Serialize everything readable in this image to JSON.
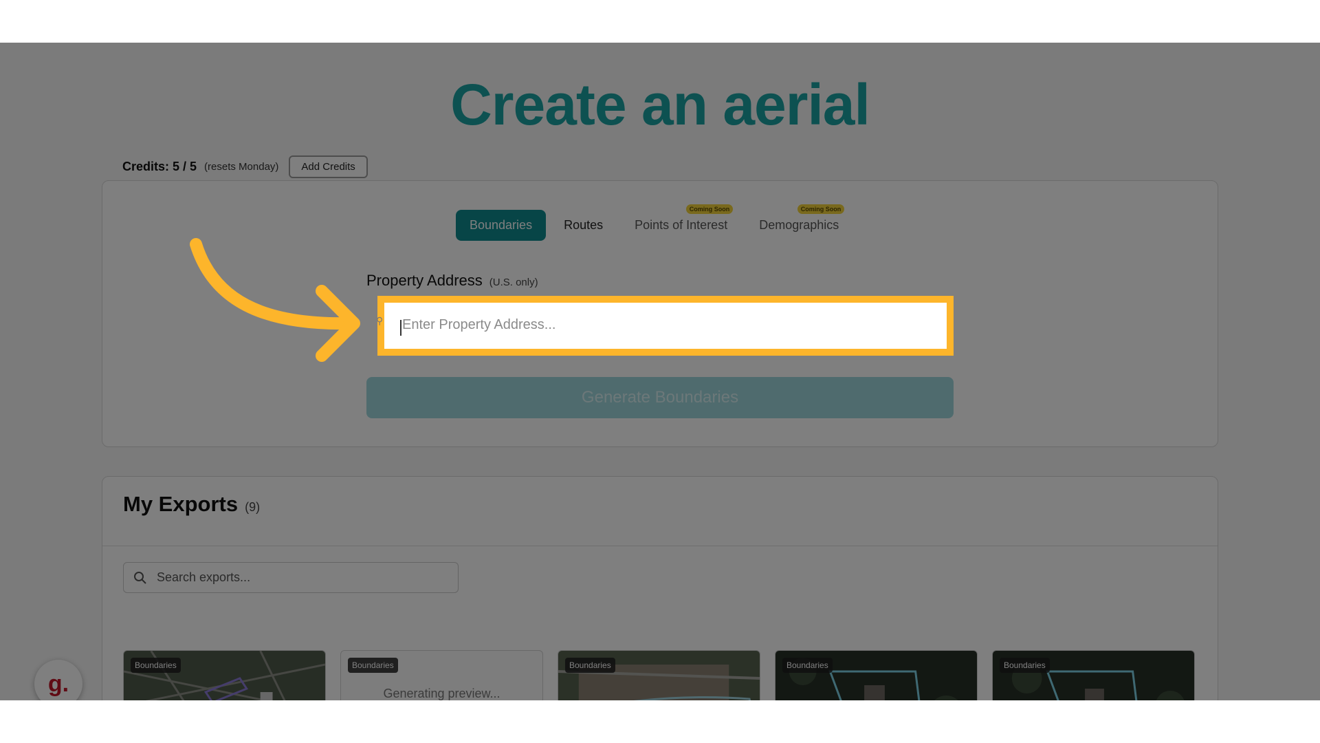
{
  "page": {
    "title": "Create an aerial"
  },
  "credits": {
    "label": "Credits: 5 / 5",
    "reset_note": "(resets Monday)",
    "add_button": "Add Credits"
  },
  "tabs": [
    {
      "label": "Boundaries",
      "active": true,
      "badge": ""
    },
    {
      "label": "Routes",
      "active": false,
      "badge": ""
    },
    {
      "label": "Points of Interest",
      "active": false,
      "badge": "Coming Soon"
    },
    {
      "label": "Demographics",
      "active": false,
      "badge": "Coming Soon"
    }
  ],
  "address": {
    "label": "Property Address",
    "hint": "(U.S. only)",
    "placeholder": "Enter Property Address..."
  },
  "generate_button": "Generate Boundaries",
  "exports": {
    "title": "My Exports",
    "count": "(9)",
    "search_placeholder": "Search exports...",
    "cards": [
      {
        "badge": "Boundaries",
        "status": ""
      },
      {
        "badge": "Boundaries",
        "status": "Generating preview..."
      },
      {
        "badge": "Boundaries",
        "status": ""
      },
      {
        "badge": "Boundaries",
        "status": ""
      },
      {
        "badge": "Boundaries",
        "status": ""
      }
    ]
  },
  "widget": {
    "letter": "g."
  },
  "colors": {
    "accent": "#0f8a8f",
    "title": "#1aa3a3",
    "highlight": "#fdb52b",
    "coming_soon": "#f3d23a"
  },
  "icons": {
    "search": "search-icon",
    "arrow": "arrow-annotation-icon"
  }
}
